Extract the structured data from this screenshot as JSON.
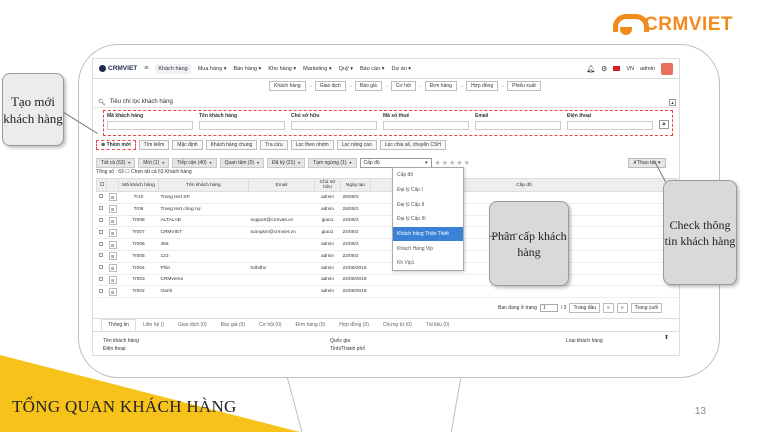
{
  "logo": {
    "name": "CRMVIET"
  },
  "slide": {
    "title": "TỔNG QUAN KHÁCH HÀNG",
    "number": "13"
  },
  "callouts": {
    "left": "Tạo mới khách hàng",
    "middle": "Phân cấp khách hàng",
    "right": "Check thông tin khách hàng"
  },
  "nav": {
    "brand": "CRMVIET",
    "items": [
      "Khách hàng",
      "Mua hàng ▾",
      "Bán hàng ▾",
      "Kho hàng ▾",
      "Marketing ▾",
      "Quỹ ▾",
      "Báo cáo ▾",
      "Dự án ▾"
    ],
    "lang": "VN",
    "user": "admin"
  },
  "workflow": [
    "Khách hàng",
    "Giao dịch",
    "Báo giá",
    "Cơ hội",
    "Đơn hàng",
    "Hợp đồng",
    "Phiếu xuất"
  ],
  "search": {
    "title": "Tiêu chí lọc khách hàng",
    "fields": [
      "Mã khách hàng",
      "Tên khách hàng",
      "Chủ sở hữu",
      "Mã số thuế",
      "Email",
      "Điện thoại"
    ]
  },
  "buttons": [
    "Thêm mới",
    "Tìm kiếm",
    "Mặc định",
    "Khách hàng chung",
    "Tra cứu",
    "Lọc theo nhóm",
    "Lọc nâng cao",
    "Lọc chia sẻ, chuyển CSH"
  ],
  "filters": [
    "Tất cả (63)",
    "Mới (1)",
    "Tiếp cận (40)",
    "Quan tâm (0)",
    "Đã ký (21)",
    "Tạm ngừng (1)"
  ],
  "level_select": "Cấp độ",
  "stars": "★★★★★",
  "thaotac": "Thao tác",
  "total_text": "Tổng số : 63 ☐ Chọn tất cả 63 Khách hàng",
  "table": {
    "headers": [
      "Mã khách hàng",
      "Tên khách hàng",
      "Email",
      "Chủ sở hữu",
      "Ngày tạo",
      "Cấp độ"
    ],
    "rows": [
      {
        "code": "Tr10",
        "name": "Trang test SP",
        "email": "",
        "owner": "admin",
        "date": "25/09/2"
      },
      {
        "code": "Tr09",
        "name": "Trang test công nợ",
        "email": "",
        "owner": "admin",
        "date": "25/09/2"
      },
      {
        "code": "Tr008",
        "name": "ALTALAB",
        "email": "support@crmviet.vn",
        "owner": "giao1",
        "date": "24/09/2"
      },
      {
        "code": "Tr007",
        "name": "CRMVIET",
        "email": "tuongsm@crmviet.vn",
        "owner": "giao1",
        "date": "24/09/2"
      },
      {
        "code": "Tr006",
        "name": "456",
        "email": "",
        "owner": "admin",
        "date": "22/09/2"
      },
      {
        "code": "Tr005",
        "name": "123",
        "email": "",
        "owner": "admin",
        "date": "22/09/2"
      },
      {
        "code": "Tr004",
        "name": "Phin",
        "email": "hdhdhx",
        "owner": "admin",
        "date": "22/09/2018"
      },
      {
        "code": "Tr003",
        "name": "CRMvemo",
        "email": "",
        "owner": "admin",
        "date": "22/09/2018"
      },
      {
        "code": "Tr002",
        "name": "Oanh",
        "email": "",
        "owner": "admin",
        "date": "22/09/2018"
      }
    ]
  },
  "dropdown": {
    "items": [
      "Cấp độ",
      "Đại lý Cấp I",
      "Đại lý Cấp II",
      "Đại lý Cấp III",
      "Khách hàng Thân Thiết",
      "Khách Hàng Vip",
      "Kh Vip1"
    ],
    "selected": 4
  },
  "pager": {
    "label": "Bạn đang ở trang",
    "page": "1",
    "of": "/ 3",
    "first": "Trang đầu",
    "prev": "«",
    "next": "»",
    "last": "Trang cuối"
  },
  "detail": {
    "tabs": [
      "Thông tin",
      "Liên hệ ()",
      "Giao dịch (0)",
      "Báo giá (0)",
      "Cơ hội (0)",
      "Đơn hàng (0)",
      "Hợp đồng (0)",
      "Chứng từ (0)",
      "Tài liệu (0)"
    ],
    "labels": {
      "name": "Tên khách hàng",
      "phone": "Điện thoại",
      "country": "Quốc gia",
      "city": "Tỉnh/Thành phố",
      "type": "Loại khách hàng"
    }
  }
}
